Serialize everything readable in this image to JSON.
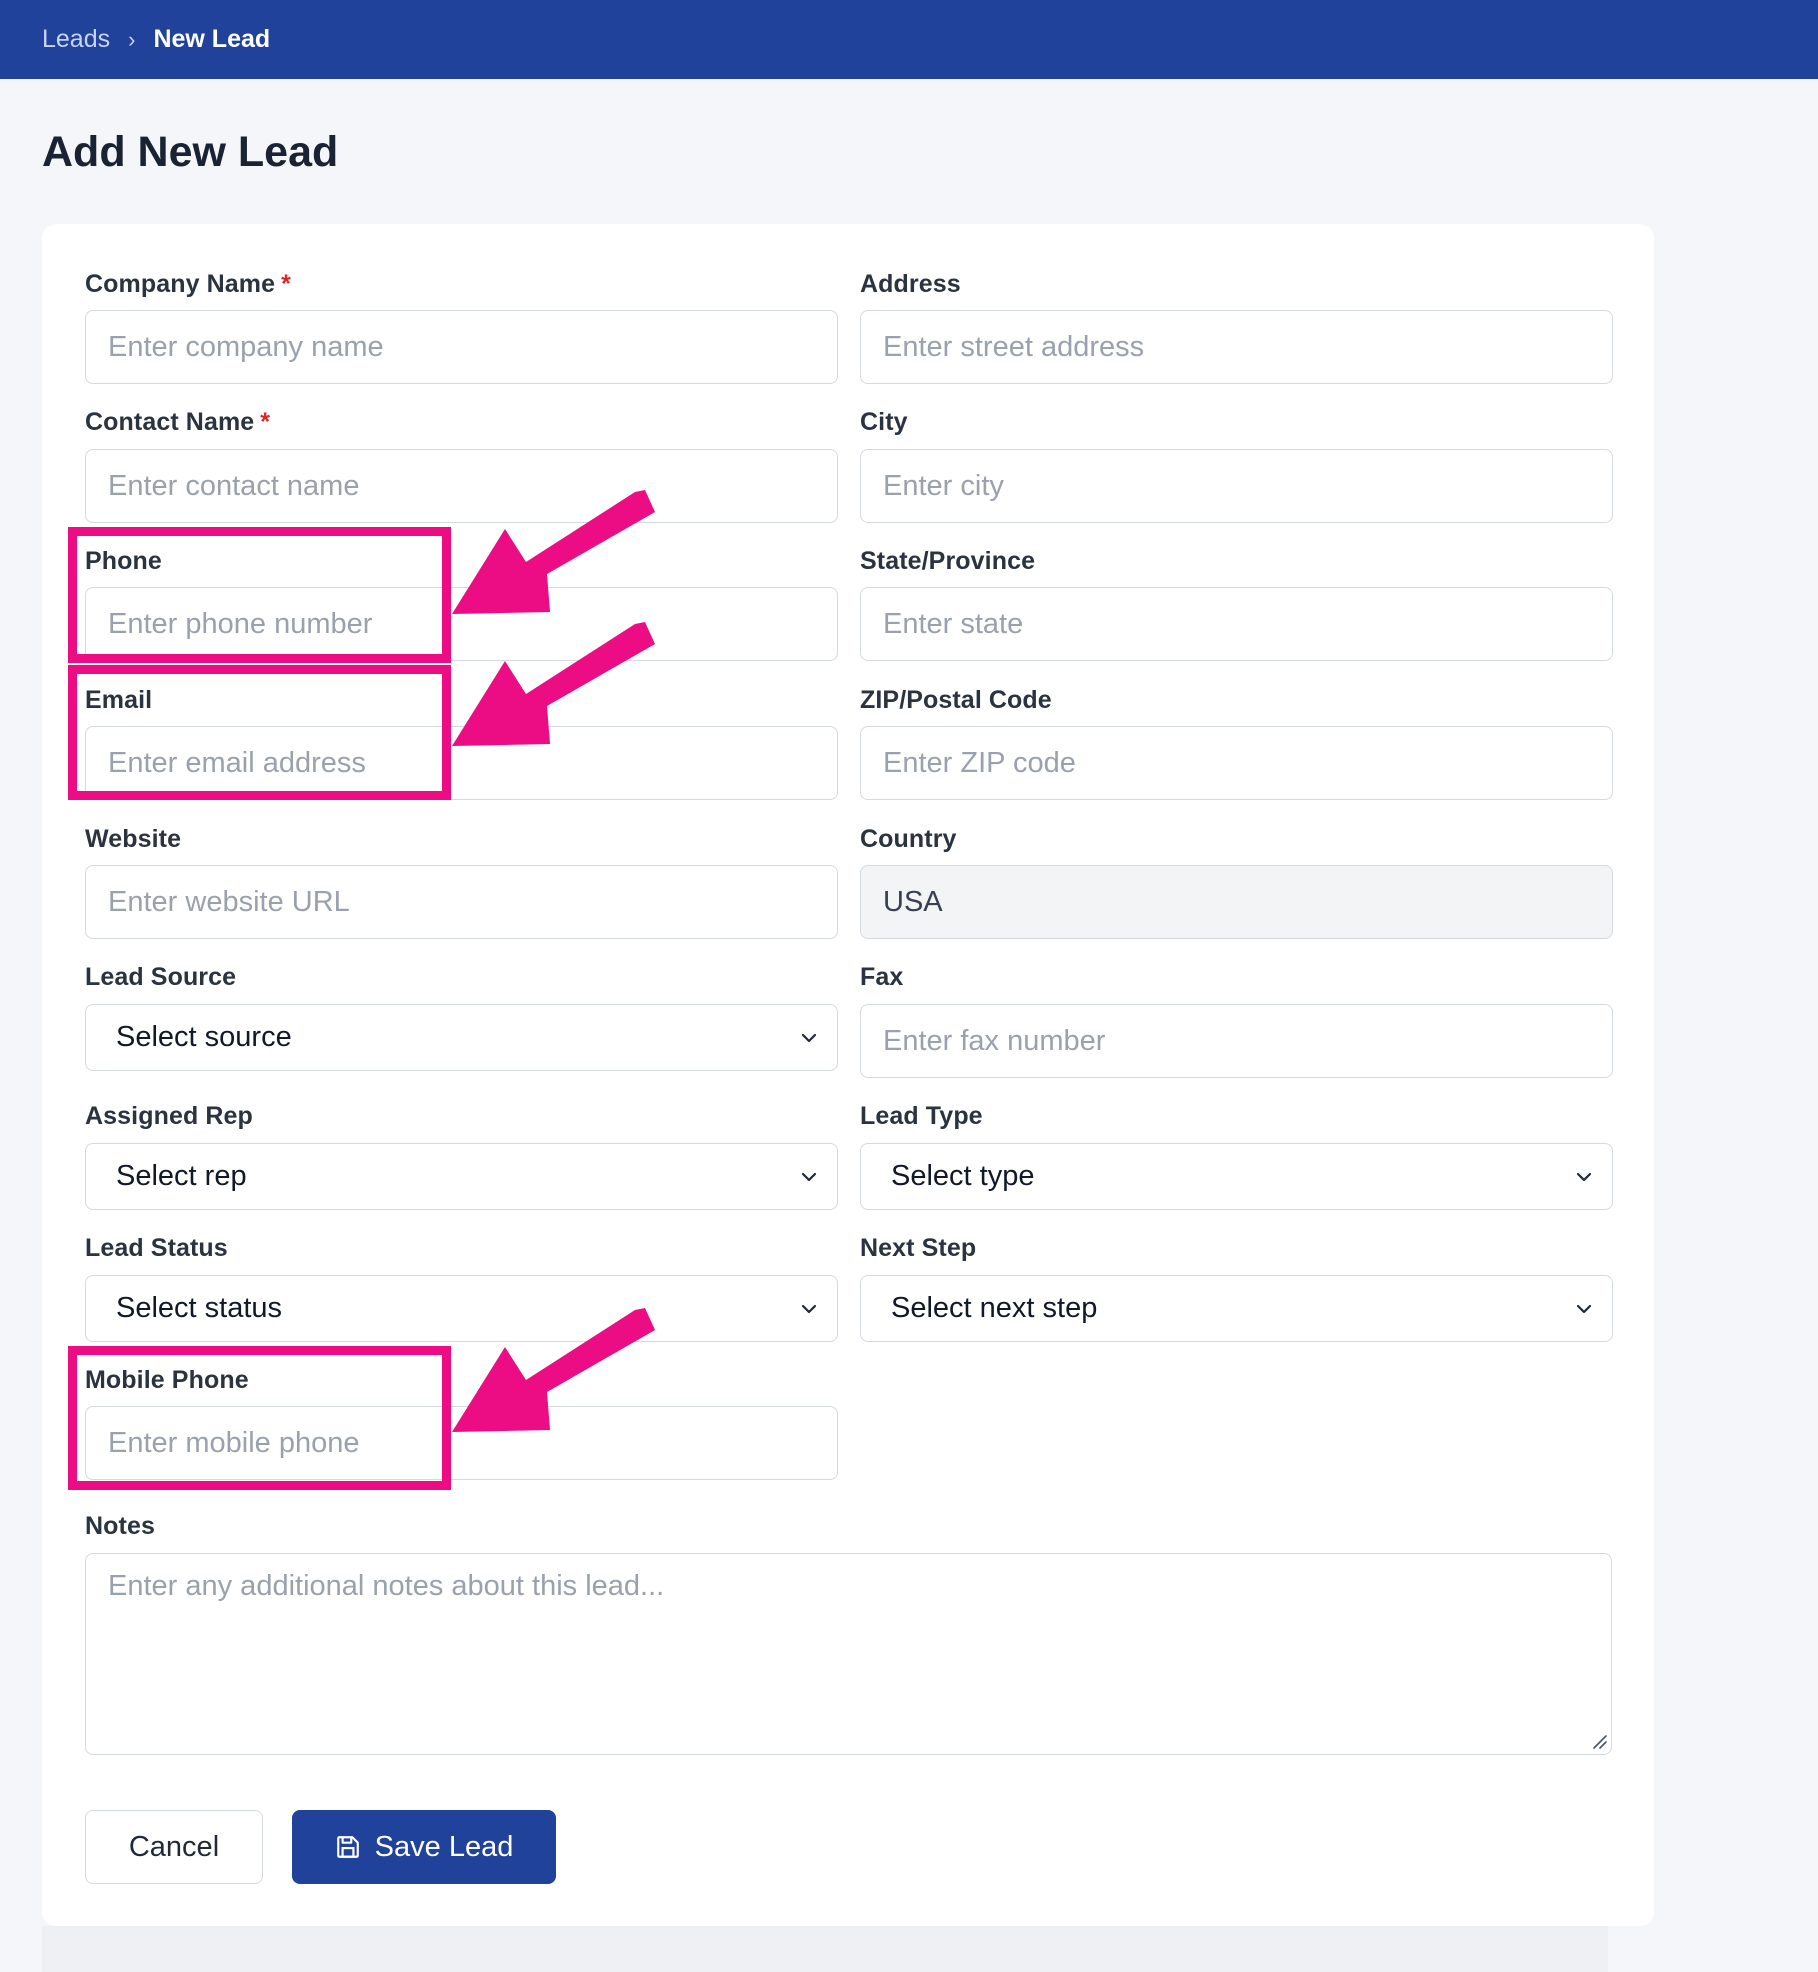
{
  "breadcrumb": {
    "parent": "Leads",
    "separator": "›",
    "current": "New Lead"
  },
  "page": {
    "title": "Add New Lead"
  },
  "form": {
    "company_name": {
      "label": "Company Name",
      "required_mark": "*",
      "placeholder": "Enter company name"
    },
    "contact_name": {
      "label": "Contact Name",
      "required_mark": "*",
      "placeholder": "Enter contact name"
    },
    "phone": {
      "label": "Phone",
      "placeholder": "Enter phone number"
    },
    "email": {
      "label": "Email",
      "placeholder": "Enter email address"
    },
    "website": {
      "label": "Website",
      "placeholder": "Enter website URL"
    },
    "lead_source": {
      "label": "Lead Source",
      "value": "Select source"
    },
    "assigned_rep": {
      "label": "Assigned Rep",
      "value": "Select rep"
    },
    "lead_status": {
      "label": "Lead Status",
      "value": "Select status"
    },
    "mobile_phone": {
      "label": "Mobile Phone",
      "placeholder": "Enter mobile phone"
    },
    "address": {
      "label": "Address",
      "placeholder": "Enter street address"
    },
    "city": {
      "label": "City",
      "placeholder": "Enter city"
    },
    "state": {
      "label": "State/Province",
      "placeholder": "Enter state"
    },
    "zip": {
      "label": "ZIP/Postal Code",
      "placeholder": "Enter ZIP code"
    },
    "country": {
      "label": "Country",
      "value": "USA"
    },
    "fax": {
      "label": "Fax",
      "placeholder": "Enter fax number"
    },
    "lead_type": {
      "label": "Lead Type",
      "value": "Select type"
    },
    "next_step": {
      "label": "Next Step",
      "value": "Select next step"
    },
    "notes": {
      "label": "Notes",
      "placeholder": "Enter any additional notes about this lead..."
    }
  },
  "actions": {
    "cancel_label": "Cancel",
    "save_label": "Save Lead"
  },
  "colors": {
    "header_bg": "#21429b",
    "primary": "#21429b",
    "required": "#e02424",
    "highlight": "#ec0c84"
  },
  "icons": {
    "save": "floppy-disk-icon",
    "select_arrow": "chevron-down-icon"
  }
}
